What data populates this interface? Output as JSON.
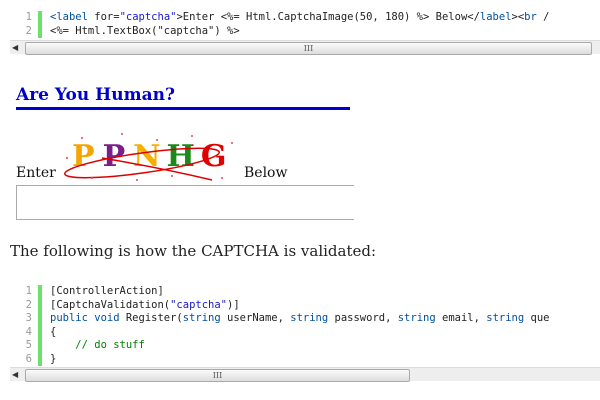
{
  "code_block_1": {
    "lines": [
      {
        "num": "1",
        "segments": [
          [
            "<label ",
            "kw"
          ],
          [
            "for",
            "tx"
          ],
          [
            "=",
            "tx"
          ],
          [
            "\"captcha\"",
            "str"
          ],
          [
            ">Enter <%= Html.CaptchaImage(50, 180) %> Below</",
            "tx"
          ],
          [
            "label",
            "kw"
          ],
          [
            "><",
            "tx"
          ],
          [
            "br",
            "kw"
          ],
          [
            " /",
            "tx"
          ]
        ]
      },
      {
        "num": "2",
        "segments": [
          [
            "<%= Html.TextBox(\"captcha\") %>",
            "tx"
          ]
        ]
      }
    ]
  },
  "form": {
    "heading": "Are You Human?",
    "enter_label": "Enter",
    "below_label": "Below",
    "captcha_text": "PPNHG",
    "input_value": ""
  },
  "paragraph": "The following is how the CAPTCHA is validated:",
  "code_block_2": {
    "lines": [
      {
        "num": "1",
        "segments": [
          [
            "[ControllerAction]",
            "tx"
          ]
        ]
      },
      {
        "num": "2",
        "segments": [
          [
            "[CaptchaValidation(",
            "tx"
          ],
          [
            "\"captcha\"",
            "str"
          ],
          [
            ")]",
            "tx"
          ]
        ]
      },
      {
        "num": "3",
        "segments": [
          [
            "public void ",
            "kw"
          ],
          [
            "Register(",
            "tx"
          ],
          [
            "string ",
            "kw"
          ],
          [
            "userName, ",
            "tx"
          ],
          [
            "string ",
            "kw"
          ],
          [
            "password, ",
            "tx"
          ],
          [
            "string ",
            "kw"
          ],
          [
            "email, ",
            "tx"
          ],
          [
            "string ",
            "kw"
          ],
          [
            "que",
            "tx"
          ]
        ]
      },
      {
        "num": "4",
        "segments": [
          [
            "{",
            "tx"
          ]
        ]
      },
      {
        "num": "5",
        "segments": [
          [
            "    // do stuff",
            "cm"
          ]
        ]
      },
      {
        "num": "6",
        "segments": [
          [
            "}",
            "tx"
          ]
        ]
      }
    ]
  },
  "scroll_grip": "III"
}
